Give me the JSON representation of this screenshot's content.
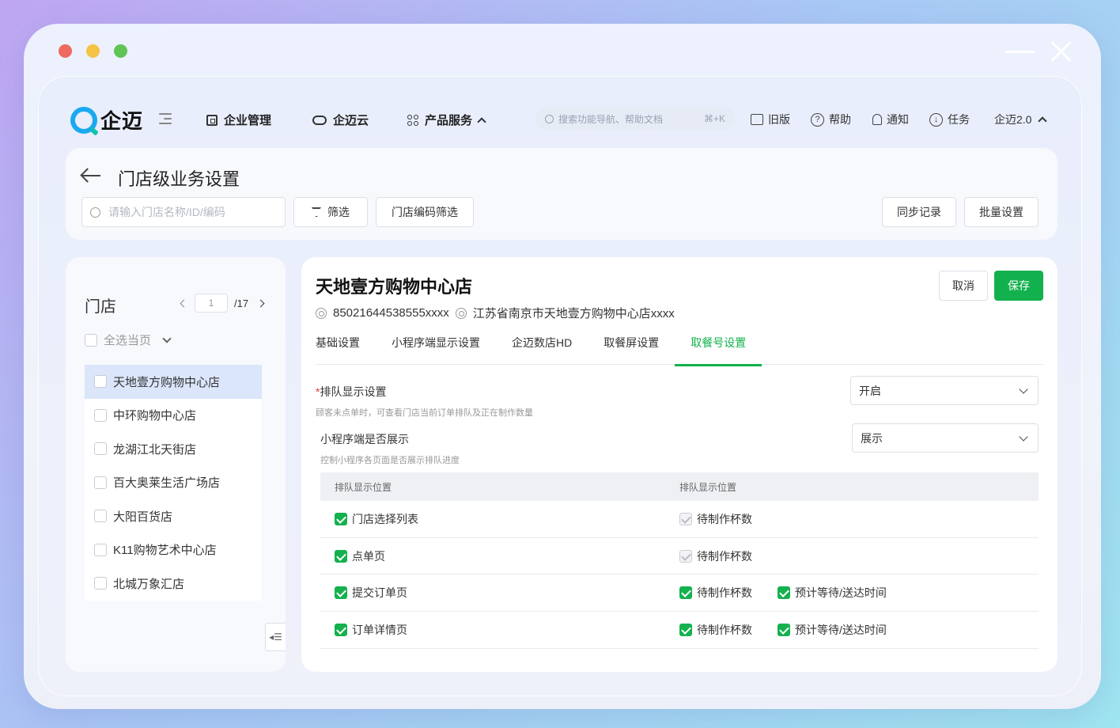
{
  "app": {
    "logo_text": "企迈",
    "nav": [
      {
        "label": "企业管理",
        "icon": "building-icon"
      },
      {
        "label": "企迈云",
        "icon": "cloud-icon"
      },
      {
        "label": "产品服务",
        "icon": "grid-icon"
      }
    ],
    "search_placeholder": "搜索功能导航、帮助文档",
    "search_shortcut": "⌘+K",
    "tools": [
      {
        "label": "旧版",
        "icon": "old-version-icon"
      },
      {
        "label": "帮助",
        "icon": "help-icon"
      },
      {
        "label": "通知",
        "icon": "bell-icon"
      },
      {
        "label": "任务",
        "icon": "download-icon"
      }
    ],
    "version_label": "企迈2.0"
  },
  "header": {
    "title": "门店级业务设置",
    "search_placeholder": "请输入门店名称/ID/编码",
    "filter_label": "筛选",
    "code_filter_label": "门店编码筛选",
    "sync_label": "同步记录",
    "batch_label": "批量设置"
  },
  "store_panel": {
    "title": "门店",
    "page_current": "1",
    "page_total": "/17",
    "select_all_label": "全选当页",
    "stores": [
      "天地壹方购物中心店",
      "中环购物中心店",
      "龙湖江北天街店",
      "百大奥莱生活广场店",
      "大阳百货店",
      "K11购物艺术中心店",
      "北城万象汇店"
    ]
  },
  "detail": {
    "store_name": "天地壹方购物中心店",
    "store_id": "85021644538555xxxx",
    "store_address": "江苏省南京市天地壹方购物中心店xxxx",
    "cancel_label": "取消",
    "save_label": "保存",
    "tabs": [
      "基础设置",
      "小程序端显示设置",
      "企迈数店HD",
      "取餐屏设置",
      "取餐号设置"
    ],
    "active_tab": 4,
    "settings": [
      {
        "required_mark": "*",
        "label": "排队显示设置",
        "desc": "顾客未点单时，可查看门店当前订单排队及正在制作数量",
        "value": "开启"
      },
      {
        "required_mark": "",
        "label": "小程序端是否展示",
        "desc": "控制小程序各页面是否展示排队进度",
        "value": "展示"
      }
    ],
    "table": {
      "headers": [
        "排队显示位置",
        "排队显示位置"
      ],
      "rows": [
        {
          "page": "门店选择列表",
          "page_checked": true,
          "options": [
            {
              "label": "待制作杯数",
              "state": "disabled"
            }
          ]
        },
        {
          "page": "点单页",
          "page_checked": true,
          "options": [
            {
              "label": "待制作杯数",
              "state": "disabled"
            }
          ]
        },
        {
          "page": "提交订单页",
          "page_checked": true,
          "options": [
            {
              "label": "待制作杯数",
              "state": "checked"
            },
            {
              "label": "预计等待/送达时间",
              "state": "checked"
            }
          ]
        },
        {
          "page": "订单详情页",
          "page_checked": true,
          "options": [
            {
              "label": "待制作杯数",
              "state": "checked"
            },
            {
              "label": "预计等待/送达时间",
              "state": "checked"
            }
          ]
        }
      ]
    }
  },
  "colors": {
    "accent": "#12b14d",
    "active_row": "#dbe6fb",
    "required": "#e03b3b"
  }
}
